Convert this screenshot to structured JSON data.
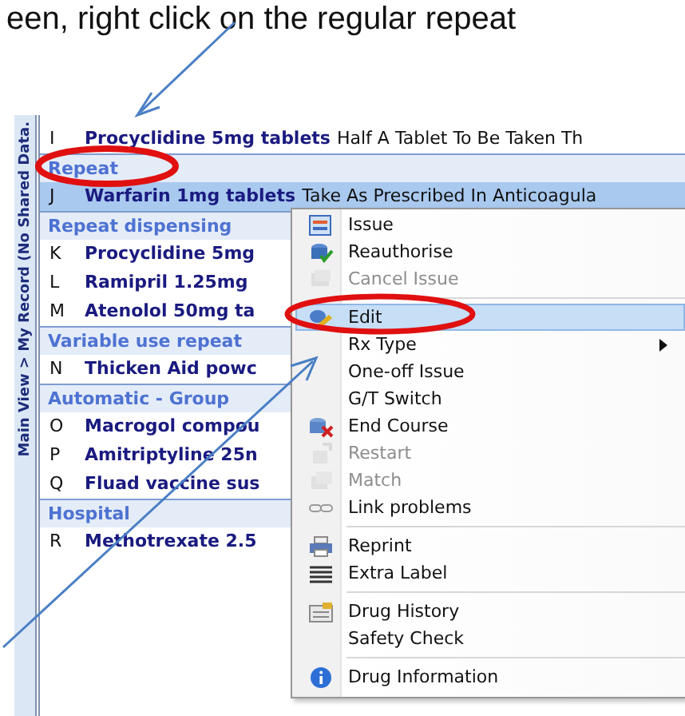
{
  "caption": "een, right click on the regular repeat",
  "sidebar_path": "Main View > My Record (No Shared Data.",
  "list": [
    {
      "kind": "row",
      "letter": "I",
      "drug": "Procyclidine 5mg tablets",
      "instructions": "Half A Tablet To Be Taken Th",
      "selected": false
    },
    {
      "kind": "group",
      "label": "Repeat"
    },
    {
      "kind": "row",
      "letter": "J",
      "drug": "Warfarin 1mg tablets",
      "instructions": "Take As Prescribed In Anticoagula",
      "selected": true
    },
    {
      "kind": "group",
      "label": "Repeat dispensing"
    },
    {
      "kind": "row",
      "letter": "K",
      "drug": "Procyclidine 5mg",
      "selected": false
    },
    {
      "kind": "row",
      "letter": "L",
      "drug": "Ramipril 1.25mg",
      "selected": false
    },
    {
      "kind": "row",
      "letter": "M",
      "drug": "Atenolol 50mg ta",
      "selected": false
    },
    {
      "kind": "group",
      "label": "Variable use repeat"
    },
    {
      "kind": "row",
      "letter": "N",
      "drug": "Thicken Aid powc",
      "selected": false
    },
    {
      "kind": "group",
      "label": "Automatic - Group"
    },
    {
      "kind": "row",
      "letter": "O",
      "drug": "Macrogol compou",
      "selected": false
    },
    {
      "kind": "row",
      "letter": "P",
      "drug": "Amitriptyline 25n",
      "selected": false
    },
    {
      "kind": "row",
      "letter": "Q",
      "drug": "Fluad vaccine sus",
      "selected": false
    },
    {
      "kind": "group",
      "label": "Hospital"
    },
    {
      "kind": "row",
      "letter": "R",
      "drug": "Methotrexate 2.5",
      "selected": false
    }
  ],
  "context_menu": {
    "items": [
      {
        "kind": "item",
        "label": "Issue",
        "disabled": false,
        "selected": false,
        "submenu": false
      },
      {
        "kind": "item",
        "label": "Reauthorise",
        "disabled": false,
        "selected": false,
        "submenu": false
      },
      {
        "kind": "item",
        "label": "Cancel Issue",
        "disabled": true,
        "selected": false,
        "submenu": false
      },
      {
        "kind": "separator"
      },
      {
        "kind": "item",
        "label": "Edit",
        "disabled": false,
        "selected": true,
        "submenu": false
      },
      {
        "kind": "item",
        "label": "Rx Type",
        "disabled": false,
        "selected": false,
        "submenu": true
      },
      {
        "kind": "item",
        "label": "One-off Issue",
        "disabled": false,
        "selected": false,
        "submenu": false
      },
      {
        "kind": "item",
        "label": "G/T Switch",
        "disabled": false,
        "selected": false,
        "submenu": false
      },
      {
        "kind": "item",
        "label": "End Course",
        "disabled": false,
        "selected": false,
        "submenu": false
      },
      {
        "kind": "item",
        "label": "Restart",
        "disabled": true,
        "selected": false,
        "submenu": false
      },
      {
        "kind": "item",
        "label": "Match",
        "disabled": true,
        "selected": false,
        "submenu": false
      },
      {
        "kind": "item",
        "label": "Link problems",
        "disabled": false,
        "selected": false,
        "submenu": false
      },
      {
        "kind": "separator"
      },
      {
        "kind": "item",
        "label": "Reprint",
        "disabled": false,
        "selected": false,
        "submenu": false
      },
      {
        "kind": "item",
        "label": "Extra Label",
        "disabled": false,
        "selected": false,
        "submenu": false
      },
      {
        "kind": "separator"
      },
      {
        "kind": "item",
        "label": "Drug History",
        "disabled": false,
        "selected": false,
        "submenu": false
      },
      {
        "kind": "item",
        "label": "Safety Check",
        "disabled": false,
        "selected": false,
        "submenu": false
      },
      {
        "kind": "separator"
      },
      {
        "kind": "item",
        "label": "Drug Information",
        "disabled": false,
        "selected": false,
        "submenu": false
      }
    ]
  }
}
